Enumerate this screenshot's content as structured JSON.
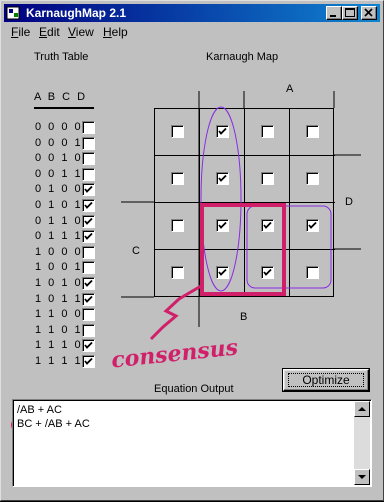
{
  "window": {
    "title": "KarnaughMap 2.1"
  },
  "menu": [
    {
      "key": "F",
      "rest": "ile"
    },
    {
      "key": "E",
      "rest": "dit"
    },
    {
      "key": "V",
      "rest": "iew"
    },
    {
      "key": "H",
      "rest": "elp"
    }
  ],
  "truth_table": {
    "title": "Truth Table",
    "header": "A B C D",
    "rows": [
      {
        "bits": "0 0 0 0",
        "checked": false
      },
      {
        "bits": "0 0 0 1",
        "checked": false
      },
      {
        "bits": "0 0 1 0",
        "checked": false
      },
      {
        "bits": "0 0 1 1",
        "checked": false
      },
      {
        "bits": "0 1 0 0",
        "checked": true
      },
      {
        "bits": "0 1 0 1",
        "checked": true
      },
      {
        "bits": "0 1 1 0",
        "checked": true
      },
      {
        "bits": "0 1 1 1",
        "checked": true
      },
      {
        "bits": "1 0 0 0",
        "checked": false
      },
      {
        "bits": "1 0 0 1",
        "checked": false
      },
      {
        "bits": "1 0 1 0",
        "checked": true
      },
      {
        "bits": "1 0 1 1",
        "checked": true
      },
      {
        "bits": "1 1 0 0",
        "checked": false
      },
      {
        "bits": "1 1 0 1",
        "checked": false
      },
      {
        "bits": "1 1 1 0",
        "checked": true
      },
      {
        "bits": "1 1 1 1",
        "checked": true
      }
    ]
  },
  "kmap": {
    "title": "Karnaugh Map",
    "label_a": "A",
    "label_b": "B",
    "label_c": "C",
    "label_d": "D",
    "cells": [
      [
        false,
        true,
        false,
        false
      ],
      [
        false,
        true,
        false,
        false
      ],
      [
        false,
        true,
        true,
        true
      ],
      [
        false,
        true,
        true,
        false
      ]
    ]
  },
  "annotation": {
    "text": "consensus",
    "color": "#d0206a",
    "group_color": "#8a2be2"
  },
  "equation": {
    "title": "Equation Output",
    "optimize_label": "Optimize",
    "line1": "/AB + AC",
    "line2_term": "BC",
    "line2_rest": " + /AB + AC"
  }
}
